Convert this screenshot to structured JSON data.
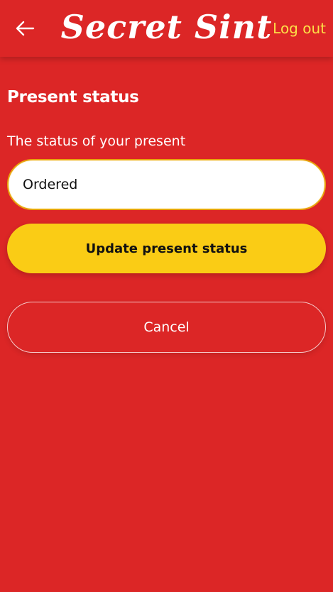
{
  "header": {
    "logo_text": "Secret Sint",
    "logout_label": "Log out",
    "back_icon": "arrow-left-icon"
  },
  "form": {
    "title": "Present status",
    "status_label": "The status of your present",
    "status_value": "Ordered",
    "update_label": "Update present status",
    "cancel_label": "Cancel"
  },
  "colors": {
    "background": "#dc2626",
    "accent": "#facc15",
    "logout_text": "#fde047",
    "input_border": "#e8a30c"
  }
}
